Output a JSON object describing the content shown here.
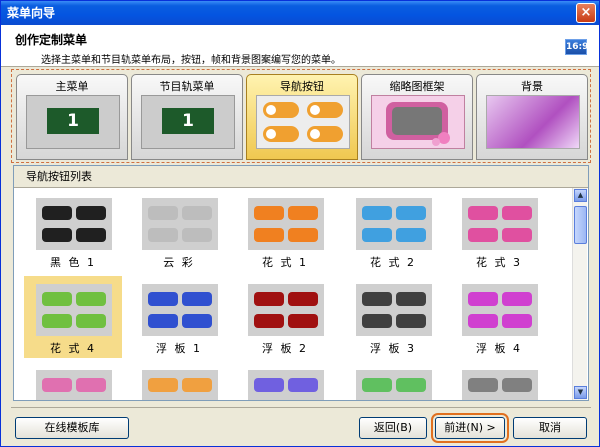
{
  "window": {
    "title": "菜单向导",
    "close_label": "×"
  },
  "header": {
    "title": "创作定制菜单",
    "description": "选择主菜单和节目轨菜单布局，按钮，帧和背景图案编写您的菜单。",
    "ratio_label": "16:9"
  },
  "tabs": [
    {
      "label": "主菜单",
      "thumb_number": "1"
    },
    {
      "label": "节目轨菜单",
      "thumb_number": "1"
    },
    {
      "label": "导航按钮"
    },
    {
      "label": "缩略图框架"
    },
    {
      "label": "背景"
    }
  ],
  "list": {
    "caption": "导航按钮列表",
    "items": [
      {
        "label": "黑 色 1",
        "color": "#202020"
      },
      {
        "label": "云 彩",
        "color": "#bdbdbd"
      },
      {
        "label": "花 式 1",
        "color": "#f08020"
      },
      {
        "label": "花 式 2",
        "color": "#40a0e0"
      },
      {
        "label": "花 式 3",
        "color": "#e050a0"
      },
      {
        "label": "花 式 4",
        "color": "#70c040"
      },
      {
        "label": "浮 板 1",
        "color": "#3050d0"
      },
      {
        "label": "浮 板 2",
        "color": "#a01010"
      },
      {
        "label": "浮 板 3",
        "color": "#404040"
      },
      {
        "label": "浮 板 4",
        "color": "#d040d0"
      },
      {
        "label": "",
        "color": "#e070b0"
      },
      {
        "label": "",
        "color": "#f0a040"
      },
      {
        "label": "",
        "color": "#7060e0"
      },
      {
        "label": "",
        "color": "#60c060"
      },
      {
        "label": "",
        "color": "#808080"
      }
    ]
  },
  "buttons": {
    "online_templates": "在线模板库",
    "back": "返回(B)",
    "next": "前进(N) >",
    "cancel": "取消"
  }
}
